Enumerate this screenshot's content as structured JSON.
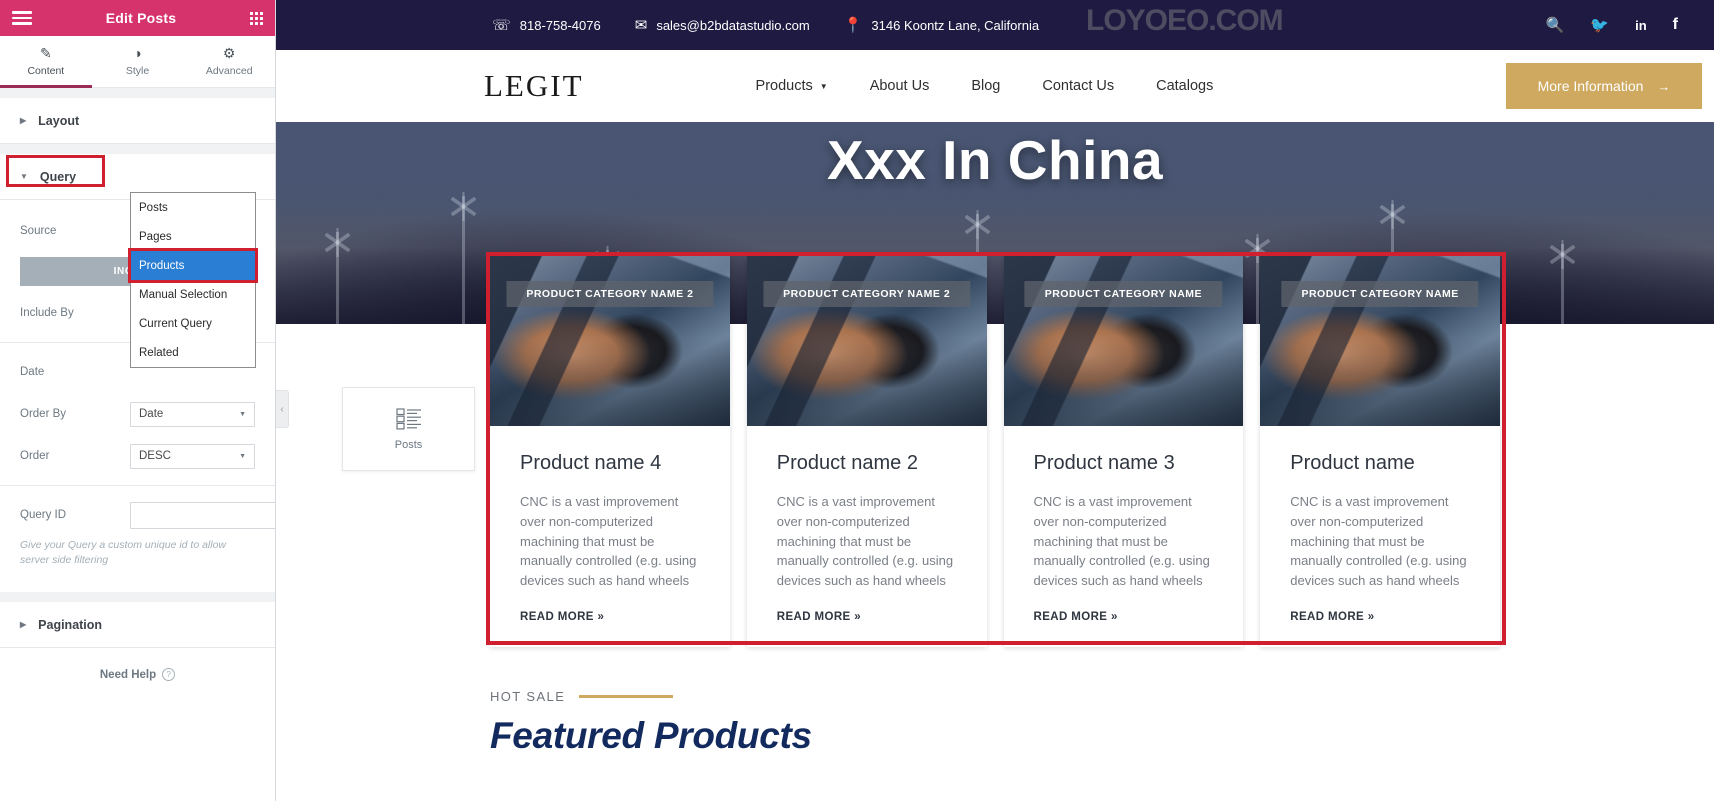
{
  "panel": {
    "header": {
      "title": "Edit Posts",
      "menu_icon": "hamburger-icon",
      "apps_icon": "grid-apps-icon"
    },
    "tabs": [
      {
        "label": "Content",
        "icon": "pencil-icon",
        "active": true
      },
      {
        "label": "Style",
        "icon": "contrast-circle-icon",
        "active": false
      },
      {
        "label": "Advanced",
        "icon": "gear-icon",
        "active": false
      }
    ],
    "sections": [
      {
        "label": "Layout",
        "state": "collapsed"
      },
      {
        "label": "Query",
        "state": "expanded",
        "highlighted": true
      },
      {
        "label": "Pagination",
        "state": "collapsed"
      }
    ],
    "controls": {
      "source_label": "Source",
      "source_value": "Products",
      "include_button": "INCLUDE",
      "include_by_label": "Include By",
      "include_by_value": "",
      "date_label": "Date",
      "order_by_label": "Order By",
      "order_by_value": "Date",
      "order_label": "Order",
      "order_value": "DESC",
      "query_id_label": "Query ID",
      "query_id_value": "",
      "query_id_placeholder": "",
      "query_id_helper": "Give your Query a custom unique id to allow server side filtering"
    },
    "dropdown": {
      "open": true,
      "options": [
        "Posts",
        "Pages",
        "Products",
        "Manual Selection",
        "Current Query",
        "Related"
      ],
      "selected": "Products"
    },
    "need_help": "Need Help",
    "highlight_color": "#d0202f",
    "brand_color": "#d6336c"
  },
  "canvas": {
    "topbar": {
      "phone": "818-758-4076",
      "email": "sales@b2bdatastudio.com",
      "address": "3146 Koontz Lane, California",
      "phone_icon": "phone-icon",
      "email_icon": "envelope-icon",
      "address_icon": "map-pin-icon",
      "watermark": "LOYOEO.COM",
      "socials": [
        {
          "name": "search-icon",
          "glyph": "⌕"
        },
        {
          "name": "twitter-icon",
          "glyph": "🐦"
        },
        {
          "name": "linkedin-icon",
          "glyph": "in"
        },
        {
          "name": "facebook-icon",
          "glyph": "f"
        }
      ]
    },
    "navbar": {
      "logo": "LEGIT",
      "links": [
        {
          "label": "Products",
          "has_dropdown": true
        },
        {
          "label": "About Us",
          "has_dropdown": false
        },
        {
          "label": "Blog",
          "has_dropdown": false
        },
        {
          "label": "Contact Us",
          "has_dropdown": false
        },
        {
          "label": "Catalogs",
          "has_dropdown": false
        }
      ],
      "cta_label": "More Information",
      "cta_arrow": "→",
      "cta_color": "#cfa95f"
    },
    "hero": {
      "title": "Xxx In China"
    },
    "products": [
      {
        "badge": "PRODUCT CATEGORY NAME 2",
        "title": "Product name 4",
        "description": "CNC is a vast improvement over non-computerized machining that must be manually controlled (e.g. using devices such as hand wheels",
        "read_more": "READ MORE »"
      },
      {
        "badge": "PRODUCT CATEGORY NAME 2",
        "title": "Product name 2",
        "description": "CNC is a vast improvement over non-computerized machining that must be manually controlled (e.g. using devices such as hand wheels",
        "read_more": "READ MORE »"
      },
      {
        "badge": "PRODUCT CATEGORY NAME",
        "title": "Product name 3",
        "description": "CNC is a vast improvement over non-computerized machining that must be manually controlled (e.g. using devices such as hand wheels",
        "read_more": "READ MORE »"
      },
      {
        "badge": "PRODUCT CATEGORY NAME",
        "title": "Product name",
        "description": "CNC is a vast improvement over non-computerized machining that must be manually controlled (e.g. using devices such as hand wheels",
        "read_more": "READ MORE »"
      }
    ],
    "featured": {
      "eyebrow": "HOT SALE",
      "title": "Featured Products"
    },
    "widget_placeholder": {
      "label": "Posts",
      "icon": "list-widget-icon"
    },
    "collapse_handle": {
      "glyph": "‹"
    }
  }
}
